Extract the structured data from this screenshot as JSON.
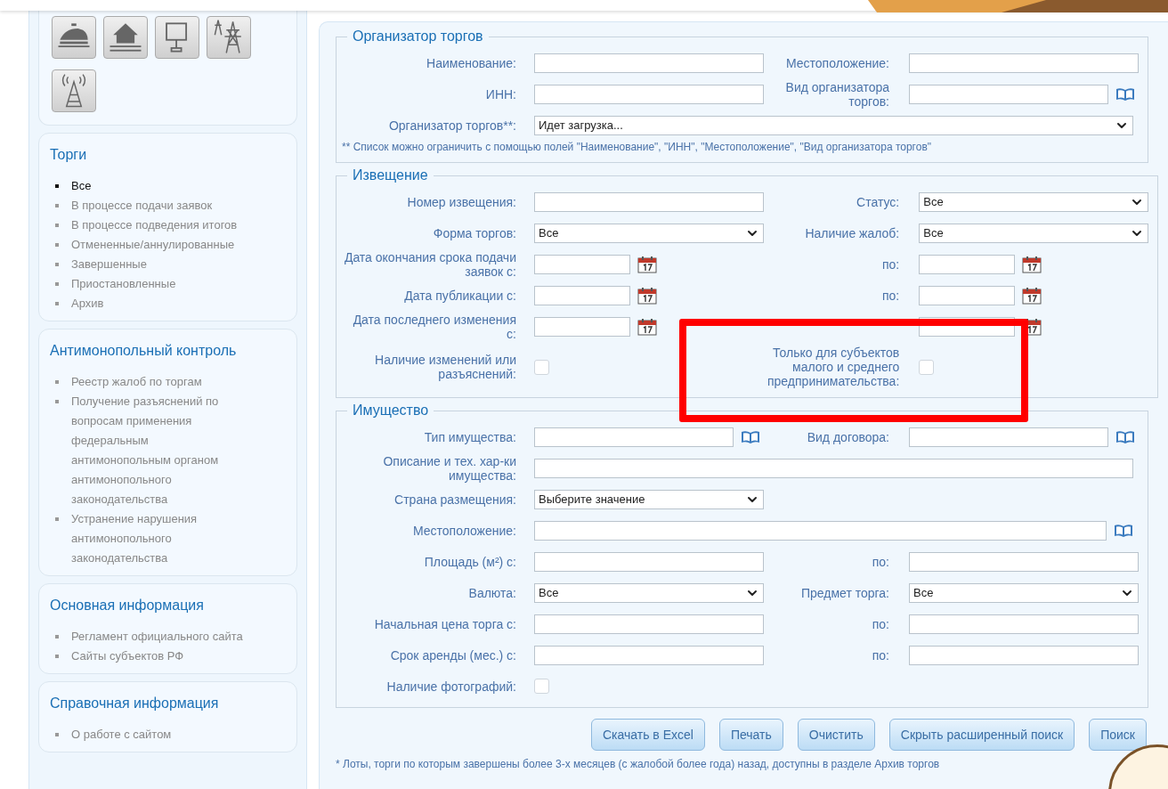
{
  "sidebar": {
    "panels": [
      {
        "title": "Торги",
        "items": [
          {
            "label": "Все",
            "selected": true
          },
          {
            "label": "В процессе подачи заявок",
            "selected": false
          },
          {
            "label": "В процессе подведения итогов",
            "selected": false
          },
          {
            "label": "Отмененные/аннулированные",
            "selected": false
          },
          {
            "label": "Завершенные",
            "selected": false
          },
          {
            "label": "Приостановленные",
            "selected": false
          },
          {
            "label": "Архив",
            "selected": false
          }
        ]
      },
      {
        "title": "Антимонопольный контроль",
        "items": [
          {
            "label": "Реестр жалоб по торгам",
            "selected": false
          },
          {
            "label": "Получение разъяснений по вопросам применения федеральным антимонопольным органом антимонопольного законодательства",
            "selected": false
          },
          {
            "label": "Устранение нарушения антимонопольного законодательства",
            "selected": false
          }
        ]
      },
      {
        "title": "Основная информация",
        "items": [
          {
            "label": "Регламент официального сайта",
            "selected": false
          },
          {
            "label": "Сайты субъектов РФ",
            "selected": false
          }
        ]
      },
      {
        "title": "Справочная информация",
        "items": [
          {
            "label": "О работе с сайтом",
            "selected": false
          }
        ]
      }
    ]
  },
  "sections": [
    {
      "legend": "Организатор торгов",
      "rows": [
        {
          "kind": "pair",
          "left": {
            "label": "Наименование:",
            "kind": "text"
          },
          "right": {
            "label": "Местоположение:",
            "kind": "text"
          }
        },
        {
          "kind": "pair",
          "left": {
            "label": "ИНН:",
            "kind": "text"
          },
          "right": {
            "label": "Вид организатора торгов:",
            "kind": "book"
          }
        },
        {
          "kind": "wide",
          "label": "Организатор торгов**:",
          "field": {
            "kind": "select",
            "value": "Идет загрузка..."
          }
        }
      ],
      "note": "** Список можно ограничить с помощью полей \"Наименование\", \"ИНН\", \"Местоположение\", \"Вид организатора торгов\""
    },
    {
      "legend": "Извещение",
      "rows": [
        {
          "kind": "pair",
          "left": {
            "label": "Номер извещения:",
            "kind": "text"
          },
          "right": {
            "label": "Статус:",
            "kind": "select",
            "value": "Все"
          }
        },
        {
          "kind": "pair",
          "left": {
            "label": "Форма торгов:",
            "kind": "select",
            "value": "Все"
          },
          "right": {
            "label": "Наличие жалоб:",
            "kind": "select",
            "value": "Все"
          }
        },
        {
          "kind": "pair",
          "left": {
            "label": "Дата окончания срока подачи заявок с:",
            "kind": "date"
          },
          "right": {
            "label": "по:",
            "kind": "date"
          }
        },
        {
          "kind": "pair",
          "left": {
            "label": "Дата публикации с:",
            "kind": "date"
          },
          "right": {
            "label": "по:",
            "kind": "date"
          }
        },
        {
          "kind": "pair",
          "left": {
            "label": "Дата последнего изменения с:",
            "kind": "date"
          },
          "right": {
            "kind": "date"
          }
        },
        {
          "kind": "pair",
          "left": {
            "label": "Наличие изменений или разъяснений:",
            "kind": "checkbox",
            "checked": false
          },
          "right": {
            "label": "Только для субъектов малого и среднего предпринимательства:",
            "kind": "checkbox",
            "checked": false
          }
        }
      ]
    },
    {
      "legend": "Имущество",
      "rows": [
        {
          "kind": "pair",
          "left": {
            "label": "Тип имущества:",
            "kind": "book"
          },
          "right": {
            "label": "Вид договора:",
            "kind": "book"
          }
        },
        {
          "kind": "wide",
          "label": "Описание и тех. хар-ки имущества:",
          "field": {
            "kind": "text"
          }
        },
        {
          "kind": "single",
          "left": {
            "label": "Страна размещения:",
            "kind": "select",
            "value": "Выберите значение"
          }
        },
        {
          "kind": "wide",
          "label": "Местоположение:",
          "field": {
            "kind": "book"
          }
        },
        {
          "kind": "pair",
          "left": {
            "label": "Площадь (м²) с:",
            "kind": "text"
          },
          "right": {
            "label": "по:",
            "kind": "text"
          }
        },
        {
          "kind": "pair",
          "left": {
            "label": "Валюта:",
            "kind": "select",
            "value": "Все"
          },
          "right": {
            "label": "Предмет торга:",
            "kind": "select",
            "value": "Все"
          }
        },
        {
          "kind": "pair",
          "left": {
            "label": "Начальная цена торга с:",
            "kind": "text"
          },
          "right": {
            "label": "по:",
            "kind": "text"
          }
        },
        {
          "kind": "pair",
          "left": {
            "label": "Срок аренды (мес.) с:",
            "kind": "text"
          },
          "right": {
            "label": "по:",
            "kind": "text"
          }
        },
        {
          "kind": "single",
          "left": {
            "label": "Наличие фотографий:",
            "kind": "checkbox",
            "checked": false
          }
        }
      ]
    }
  ],
  "buttons": [
    "Скачать в Excel",
    "Печать",
    "Очистить",
    "Скрыть расширенный поиск",
    "Поиск"
  ],
  "footnote": "* Лоты, торги по которым завершены более 3-х месяцев (с жалобой более года) назад, доступны в разделе Архив торгов"
}
